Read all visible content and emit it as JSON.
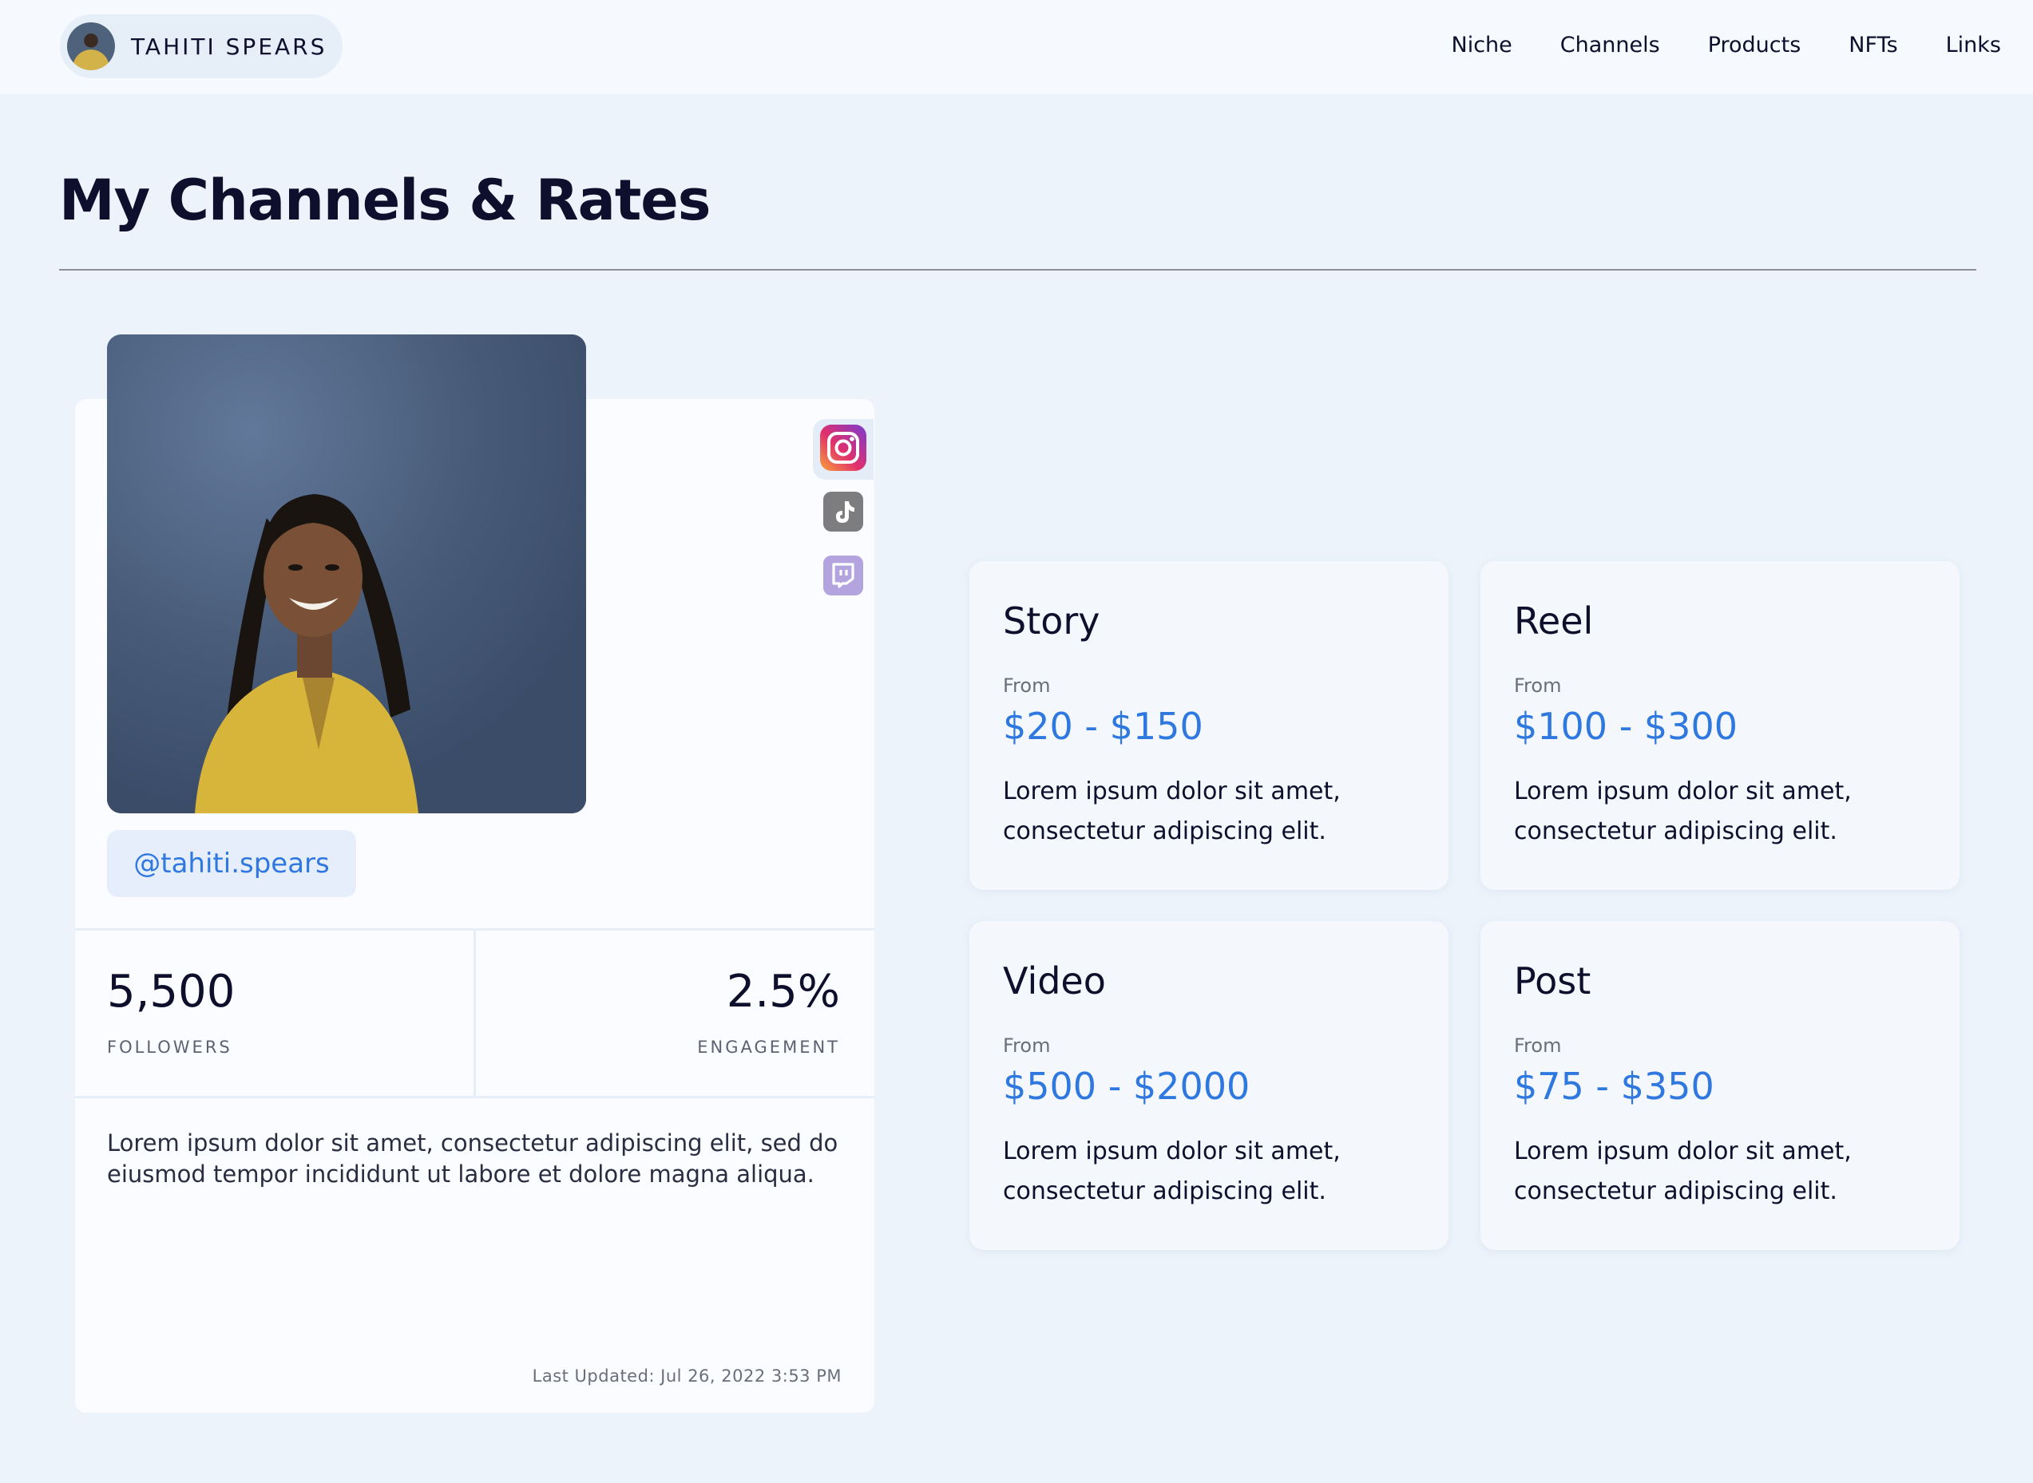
{
  "header": {
    "profile_name": "TAHITI SPEARS",
    "nav": [
      "Niche",
      "Channels",
      "Products",
      "NFTs",
      "Links"
    ]
  },
  "page": {
    "title": "My Channels & Rates"
  },
  "profile": {
    "handle": "@tahiti.spears",
    "channels": [
      "instagram",
      "tiktok",
      "twitch"
    ],
    "active_channel": "instagram",
    "stats": {
      "followers_value": "5,500",
      "followers_label": "FOLLOWERS",
      "engagement_value": "2.5%",
      "engagement_label": "ENGAGEMENT"
    },
    "bio": "Lorem ipsum dolor sit amet, consectetur adipiscing elit, sed do eiusmod tempor incididunt ut labore et dolore magna aliqua.",
    "last_updated": "Last Updated: Jul 26, 2022 3:53 PM"
  },
  "rates": [
    {
      "title": "Story",
      "from": "From",
      "price": "$20 - $150",
      "desc": "Lorem ipsum dolor sit amet, consectetur adipiscing elit."
    },
    {
      "title": "Reel",
      "from": "From",
      "price": "$100 - $300",
      "desc": "Lorem ipsum dolor sit amet, consectetur adipiscing elit."
    },
    {
      "title": "Video",
      "from": "From",
      "price": "$500 - $2000",
      "desc": "Lorem ipsum dolor sit amet, consectetur adipiscing elit."
    },
    {
      "title": "Post",
      "from": "From",
      "price": "$75 - $350",
      "desc": "Lorem ipsum dolor sit amet, consectetur adipiscing elit."
    }
  ],
  "colors": {
    "accent": "#2f78e0",
    "background": "#ecf3fb",
    "text": "#0d0f2c"
  }
}
